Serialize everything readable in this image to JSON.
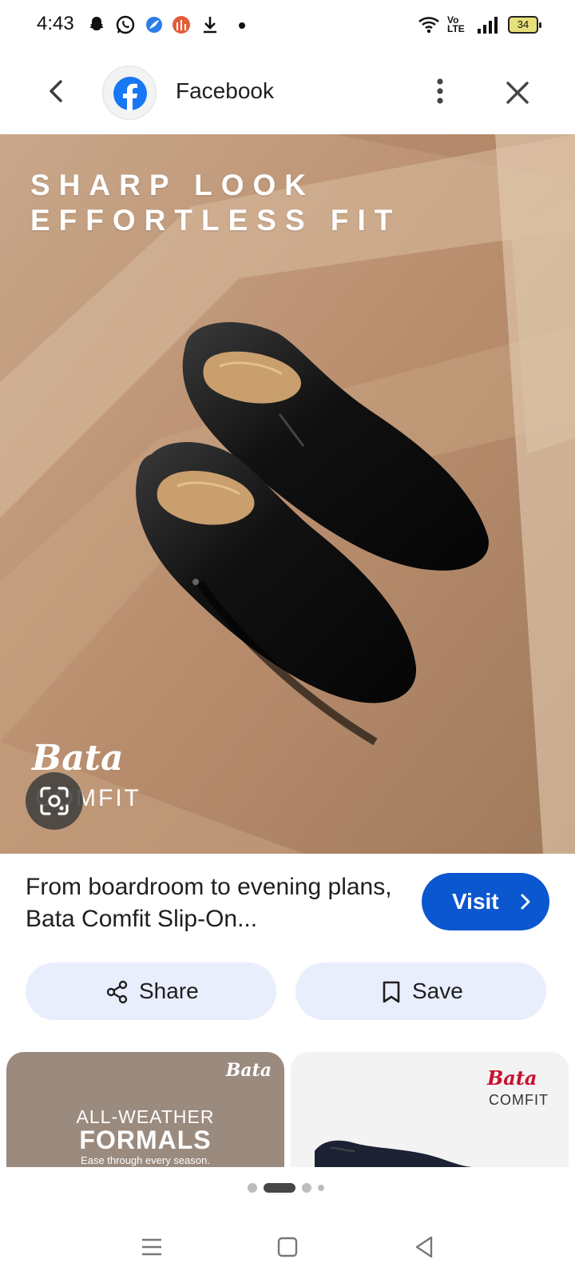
{
  "status_bar": {
    "time": "4:43",
    "icons": [
      "snapchat-icon",
      "whatsapp-icon",
      "browser-app-icon",
      "app-notification-icon",
      "download-icon",
      "notification-dot"
    ],
    "right_icons": [
      "wifi-icon",
      "volte-icon",
      "signal-icon",
      "battery-icon"
    ],
    "volte_label": "Vo\nLTE",
    "battery_level": "34"
  },
  "header": {
    "source_name": "Facebook",
    "back_icon": "chevron-left-icon",
    "more_icon": "more-vertical-icon",
    "close_icon": "close-icon"
  },
  "hero": {
    "headline": "SHARP LOOK\nEFFORTLESS FIT",
    "brand": "Bata",
    "brand_sub": "COMFIT",
    "lens_icon": "google-lens-icon"
  },
  "result": {
    "caption": "From boardroom to evening plans, Bata Comfit Slip-On...",
    "visit_label": "Visit",
    "share_label": "Share",
    "save_label": "Save"
  },
  "related": [
    {
      "brand": "Bata",
      "line1": "ALL-WEATHER",
      "line2": "FORMALS",
      "line3": "Ease through every season."
    },
    {
      "brand": "Bata",
      "sub": "COMFIT"
    }
  ],
  "pager": {
    "count": 4,
    "active_index": 1
  },
  "colors": {
    "accent": "#0b57d0",
    "pill_bg": "#e8eefc",
    "facebook_blue": "#1877f2"
  },
  "nav": [
    "menu-icon",
    "home-icon",
    "back-triangle-icon"
  ]
}
